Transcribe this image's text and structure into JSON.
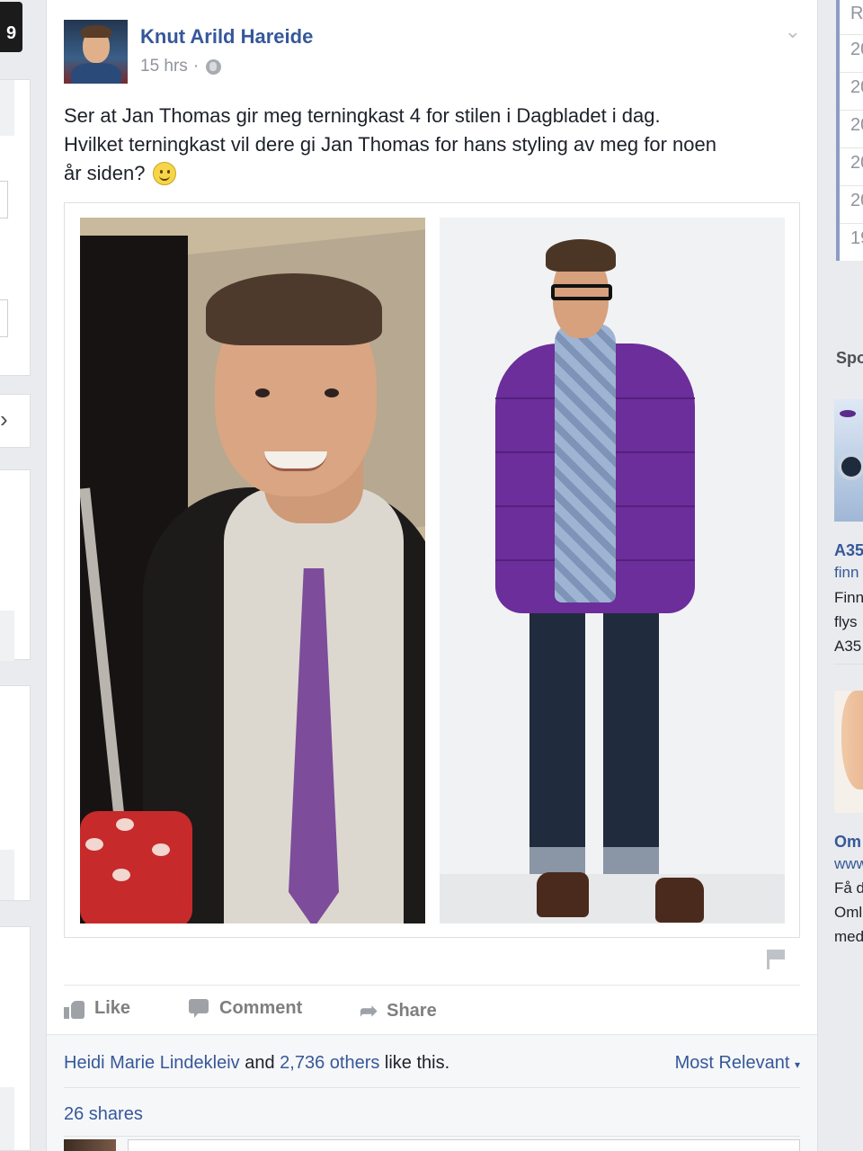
{
  "left_badge": "9",
  "post": {
    "author": "Knut Arild Hareide",
    "time": "15 hrs",
    "separator": "·",
    "text_line1": "Ser at Jan Thomas gir meg terningkast 4 for stilen i Dagbladet i dag.",
    "text_line2": "Hvilket terningkast vil dere gi Jan Thomas for hans styling av meg for noen",
    "text_line3": "år siden?",
    "emoji": "smiley",
    "photos": [
      "man-in-suit-purple-tie-with-red-die",
      "man-in-purple-jacket-and-scarf"
    ]
  },
  "actions": {
    "like": "Like",
    "comment": "Comment",
    "share": "Share"
  },
  "stats": {
    "liker": "Heidi Marie Lindekleiv",
    "and": "and",
    "others": "2,736 others",
    "like_this": "like this.",
    "sort": "Most Relevant",
    "shares": "26 shares"
  },
  "right_column": {
    "header": "R",
    "years": [
      "20",
      "20",
      "20",
      "20",
      "20",
      "19"
    ],
    "sponsored": "Spo",
    "ad1": {
      "title": "A35",
      "link": "finn",
      "lines": [
        "Finn",
        "flys",
        "A35"
      ]
    },
    "ad2": {
      "title": "Om",
      "link": "www",
      "lines": [
        "Få d",
        "Oml",
        "med"
      ]
    }
  },
  "colors": {
    "link": "#365899",
    "brand_bar": "#8b9dc3",
    "background": "#e9ebee"
  }
}
